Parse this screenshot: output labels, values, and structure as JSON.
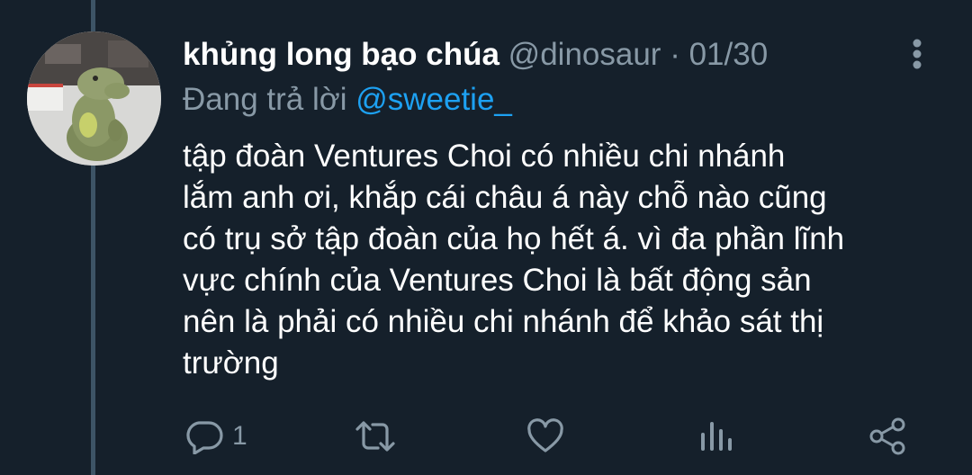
{
  "tweet": {
    "display_name": "khủng long bạo chúa",
    "handle": "@dinosaur",
    "separator": "·",
    "date": "01/30",
    "reply_prefix": "Đang trả lời",
    "reply_to": "@sweetie_",
    "body_lines": [
      "tập đoàn Ventures Choi có nhiều chi nhánh",
      "lắm anh ơi, khắp cái châu á này chỗ nào cũng",
      "có trụ sở tập đoàn của họ hết á. vì đa phần lĩnh",
      "vực chính của Ventures Choi là bất động sản",
      "nên là phải có nhiều chi nhánh để khảo sát thị",
      "trường"
    ]
  },
  "actions": {
    "reply": {
      "icon": "reply-icon",
      "count": "1"
    },
    "retweet": {
      "icon": "retweet-icon"
    },
    "like": {
      "icon": "heart-icon"
    },
    "analytics": {
      "icon": "analytics-icon"
    },
    "share": {
      "icon": "share-icon"
    }
  },
  "colors": {
    "background": "#15202b",
    "secondary_text": "#8899a6",
    "link": "#1da1f2",
    "thread_line": "#3d5466"
  }
}
